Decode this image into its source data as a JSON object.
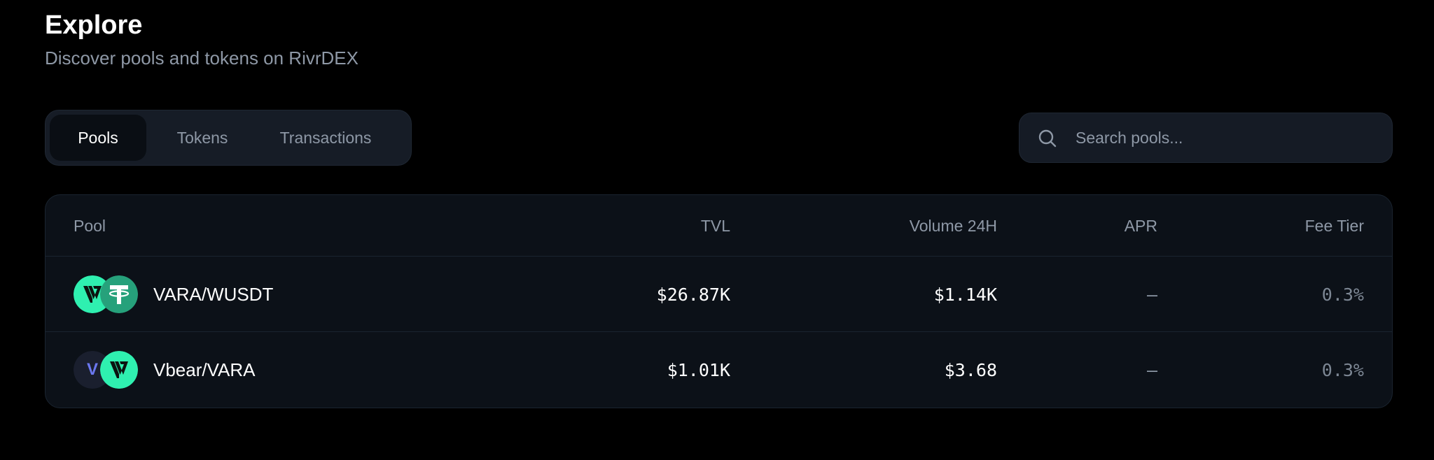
{
  "header": {
    "title": "Explore",
    "subtitle": "Discover pools and tokens on RivrDEX"
  },
  "tabs": [
    {
      "label": "Pools",
      "active": true
    },
    {
      "label": "Tokens",
      "active": false
    },
    {
      "label": "Transactions",
      "active": false
    }
  ],
  "search": {
    "placeholder": "Search pools...",
    "value": "",
    "icon": "search-icon"
  },
  "table": {
    "columns": [
      "Pool",
      "TVL",
      "Volume 24H",
      "APR",
      "Fee Tier"
    ],
    "rows": [
      {
        "pool": "VARA/WUSDT",
        "tokens": [
          "vara-logo-icon",
          "tether-logo-icon"
        ],
        "tvl": "$26.87K",
        "volume_24h": "$1.14K",
        "apr": "—",
        "fee_tier": "0.3%"
      },
      {
        "pool": "Vbear/VARA",
        "tokens": [
          "vbear-letter-icon",
          "vara-logo-icon"
        ],
        "token_letter": "V",
        "tvl": "$1.01K",
        "volume_24h": "$3.68",
        "apr": "—",
        "fee_tier": "0.3%"
      }
    ]
  },
  "colors": {
    "background": "#000000",
    "panel": "#0c1118",
    "tabs_bg": "#161c26",
    "muted_text": "#8e98a6",
    "vara_green": "#2ff0b0",
    "tether_green": "#26a17b",
    "vbear_letter": "#6b78f0"
  }
}
